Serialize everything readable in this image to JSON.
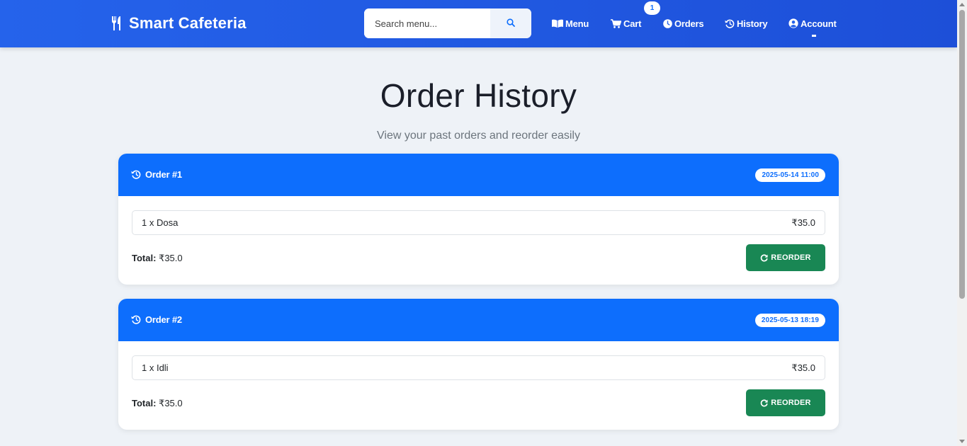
{
  "navbar": {
    "brand": "Smart Cafeteria",
    "brand_icon": "utensils-icon",
    "search": {
      "placeholder": "Search menu...",
      "value": ""
    },
    "items": [
      {
        "label": "Menu",
        "icon": "book-open-icon"
      },
      {
        "label": "Cart",
        "icon": "shopping-cart-icon",
        "badge": "1"
      },
      {
        "label": "Orders",
        "icon": "clock-icon"
      },
      {
        "label": "History",
        "icon": "history-icon"
      },
      {
        "label": "Account",
        "icon": "user-circle-icon"
      }
    ]
  },
  "page": {
    "title": "Order History",
    "subtitle": "View your past orders and reorder easily"
  },
  "orders": [
    {
      "title": "Order #1",
      "date": "2025-05-14 11:00",
      "items": [
        {
          "name": "1 x Dosa",
          "price": "₹35.0"
        }
      ],
      "total_label": "Total:",
      "total_value": "₹35.0",
      "reorder_label": "REORDER"
    },
    {
      "title": "Order #2",
      "date": "2025-05-13 18:19",
      "items": [
        {
          "name": "1 x Idli",
          "price": "₹35.0"
        }
      ],
      "total_label": "Total:",
      "total_value": "₹35.0",
      "reorder_label": "REORDER"
    }
  ],
  "colors": {
    "navbar": "#2563eb",
    "card_header": "#0d6efd",
    "reorder_button": "#198754",
    "background": "#eef2f7"
  }
}
